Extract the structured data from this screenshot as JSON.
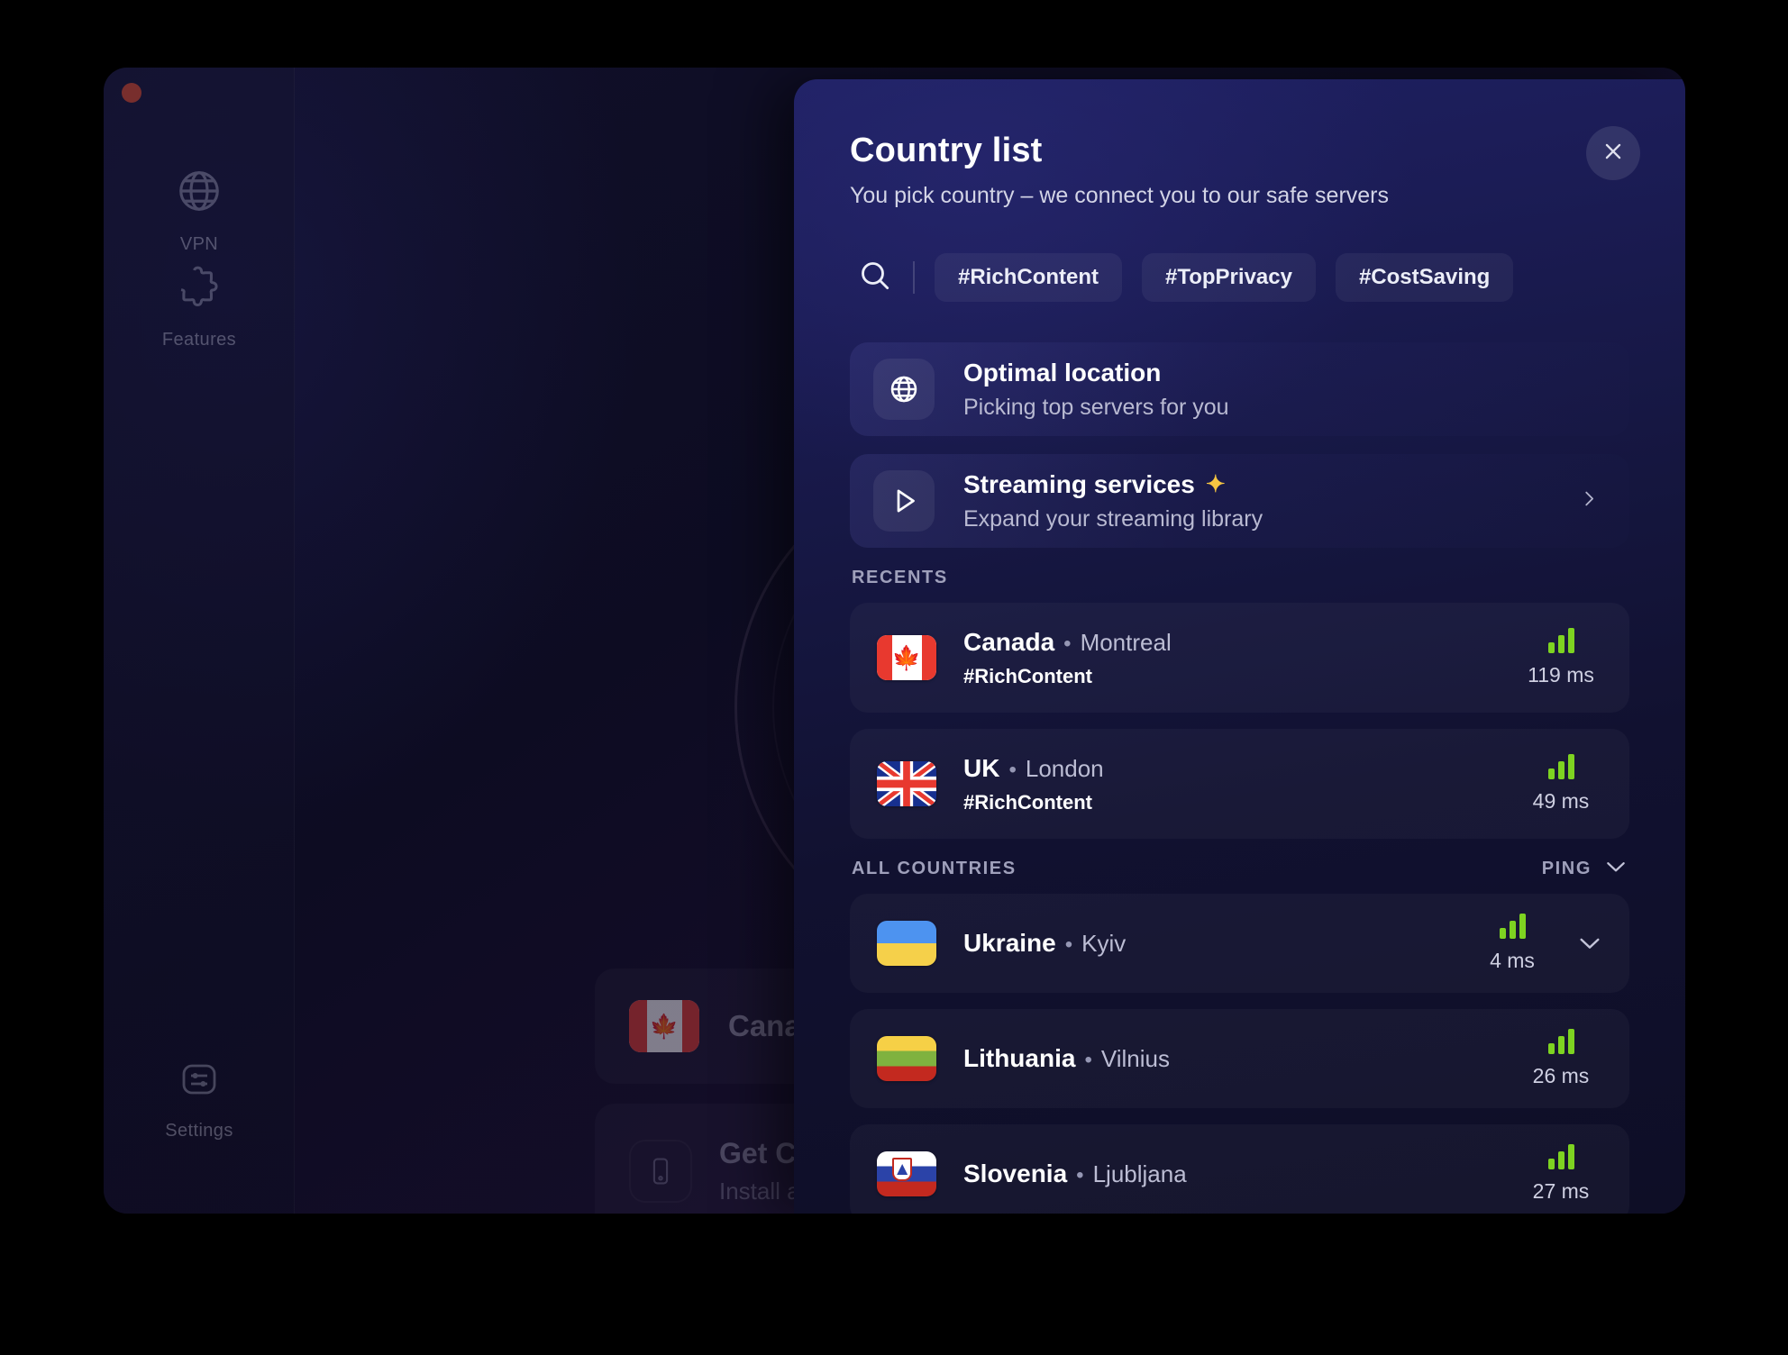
{
  "window": {
    "traffic_lights": [
      "close"
    ]
  },
  "sidebar": {
    "items": [
      {
        "label": "VPN",
        "icon": "globe-icon"
      },
      {
        "label": "Features",
        "icon": "puzzle-icon"
      }
    ],
    "bottom": {
      "label": "Settings",
      "icon": "sliders-icon"
    }
  },
  "background": {
    "canada_card": {
      "label": "Canada",
      "flag": "ca"
    },
    "promo": {
      "title": "Get ClearV",
      "subtitle": "Install app o",
      "icon": "phone-icon"
    }
  },
  "panel": {
    "title": "Country list",
    "subtitle": "You pick country – we connect you to our safe servers",
    "close_icon": "close-icon",
    "search": {
      "icon": "search-icon",
      "placeholder": ""
    },
    "chips": [
      "#RichContent",
      "#TopPrivacy",
      "#CostSaving"
    ],
    "features": [
      {
        "title": "Optimal location",
        "subtitle": "Picking top servers for you",
        "icon": "globe-icon",
        "badge": "",
        "has_chevron": false
      },
      {
        "title": "Streaming services",
        "subtitle": "Expand your streaming library",
        "icon": "play-icon",
        "badge": "✦",
        "has_chevron": true
      }
    ],
    "recents": {
      "label": "RECENTS",
      "rows": [
        {
          "country": "Canada",
          "sep": "•",
          "city": "Montreal",
          "tag": "#RichContent",
          "ping": "119 ms",
          "flag": "ca",
          "expandable": false
        },
        {
          "country": "UK",
          "sep": "•",
          "city": "London",
          "tag": "#RichContent",
          "ping": "49 ms",
          "flag": "uk",
          "expandable": false
        }
      ]
    },
    "all_countries": {
      "label": "ALL COUNTRIES",
      "sort_label": "PING",
      "sort_icon": "chevron-down-icon",
      "rows": [
        {
          "country": "Ukraine",
          "sep": "•",
          "city": "Kyiv",
          "tag": "",
          "ping": "4 ms",
          "flag": "ua",
          "expandable": true
        },
        {
          "country": "Lithuania",
          "sep": "•",
          "city": "Vilnius",
          "tag": "",
          "ping": "26 ms",
          "flag": "lt",
          "expandable": false
        },
        {
          "country": "Slovenia",
          "sep": "•",
          "city": "Ljubljana",
          "tag": "",
          "ping": "27 ms",
          "flag": "si",
          "expandable": false
        }
      ]
    }
  },
  "colors": {
    "accent_green": "#7ed321",
    "panel_blue": "#1e2062",
    "traffic_close": "#f2502a"
  }
}
